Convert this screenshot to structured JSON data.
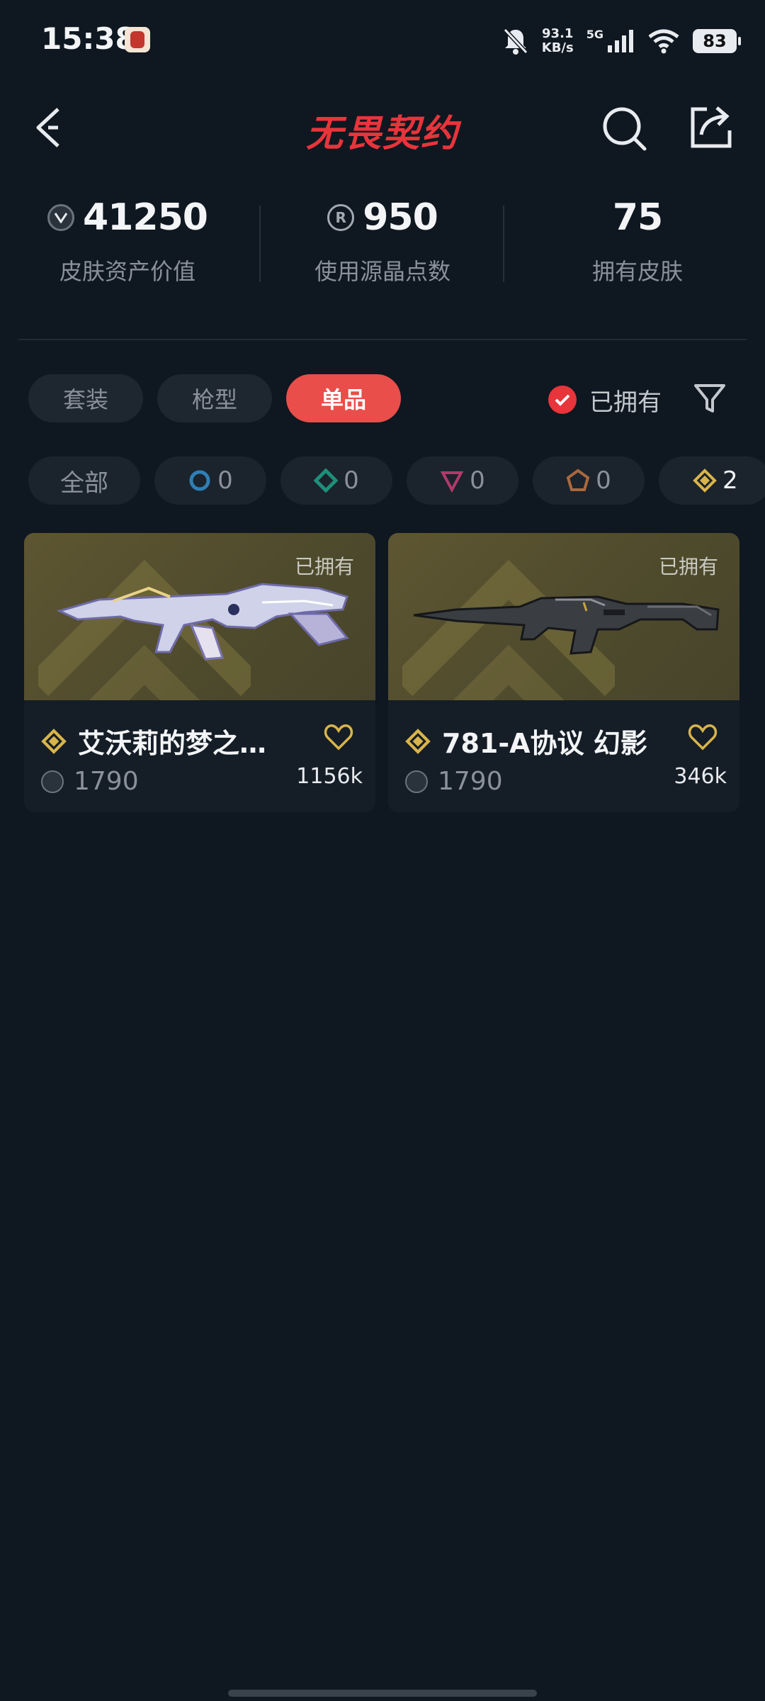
{
  "status_bar": {
    "time": "15:38",
    "net_speed_value": "93.1",
    "net_speed_unit": "KB/s",
    "signal_label": "5G",
    "battery": "83"
  },
  "header": {
    "title": "无畏契约",
    "title_color": "#e8343b",
    "back_icon": "back-arrow-icon",
    "search_icon": "search-icon",
    "share_icon": "share-icon"
  },
  "stats": [
    {
      "value": "41250",
      "label": "皮肤资产价值",
      "icon": "vp-coin-icon"
    },
    {
      "value": "950",
      "label": "使用源晶点数",
      "icon": "radianite-coin-icon",
      "icon_text": "R"
    },
    {
      "value": "75",
      "label": "拥有皮肤"
    }
  ],
  "tabs": [
    {
      "label": "套装",
      "active": false
    },
    {
      "label": "枪型",
      "active": false
    },
    {
      "label": "单品",
      "active": true
    }
  ],
  "owned_filter": {
    "label": "已拥有",
    "checked": true
  },
  "rarity_chips": [
    {
      "label": "全部"
    },
    {
      "count": "0",
      "icon": "select-tier-icon",
      "color": "#2f7fb5"
    },
    {
      "count": "0",
      "icon": "deluxe-tier-icon",
      "color": "#1e8f7a"
    },
    {
      "count": "0",
      "icon": "premium-tier-icon",
      "color": "#b03a6a"
    },
    {
      "count": "0",
      "icon": "ultra-tier-icon",
      "color": "#a8693e"
    },
    {
      "count": "2",
      "icon": "exclusive-tier-icon",
      "color": "#d8b44a"
    }
  ],
  "items": [
    {
      "name": "艾沃莉的梦之…",
      "owned_tag": "已拥有",
      "price": "1790",
      "likes": "1156k"
    },
    {
      "name": "781-A协议 幻影",
      "owned_tag": "已拥有",
      "price": "1790",
      "likes": "346k"
    }
  ],
  "accent_color": "#e94e4a"
}
